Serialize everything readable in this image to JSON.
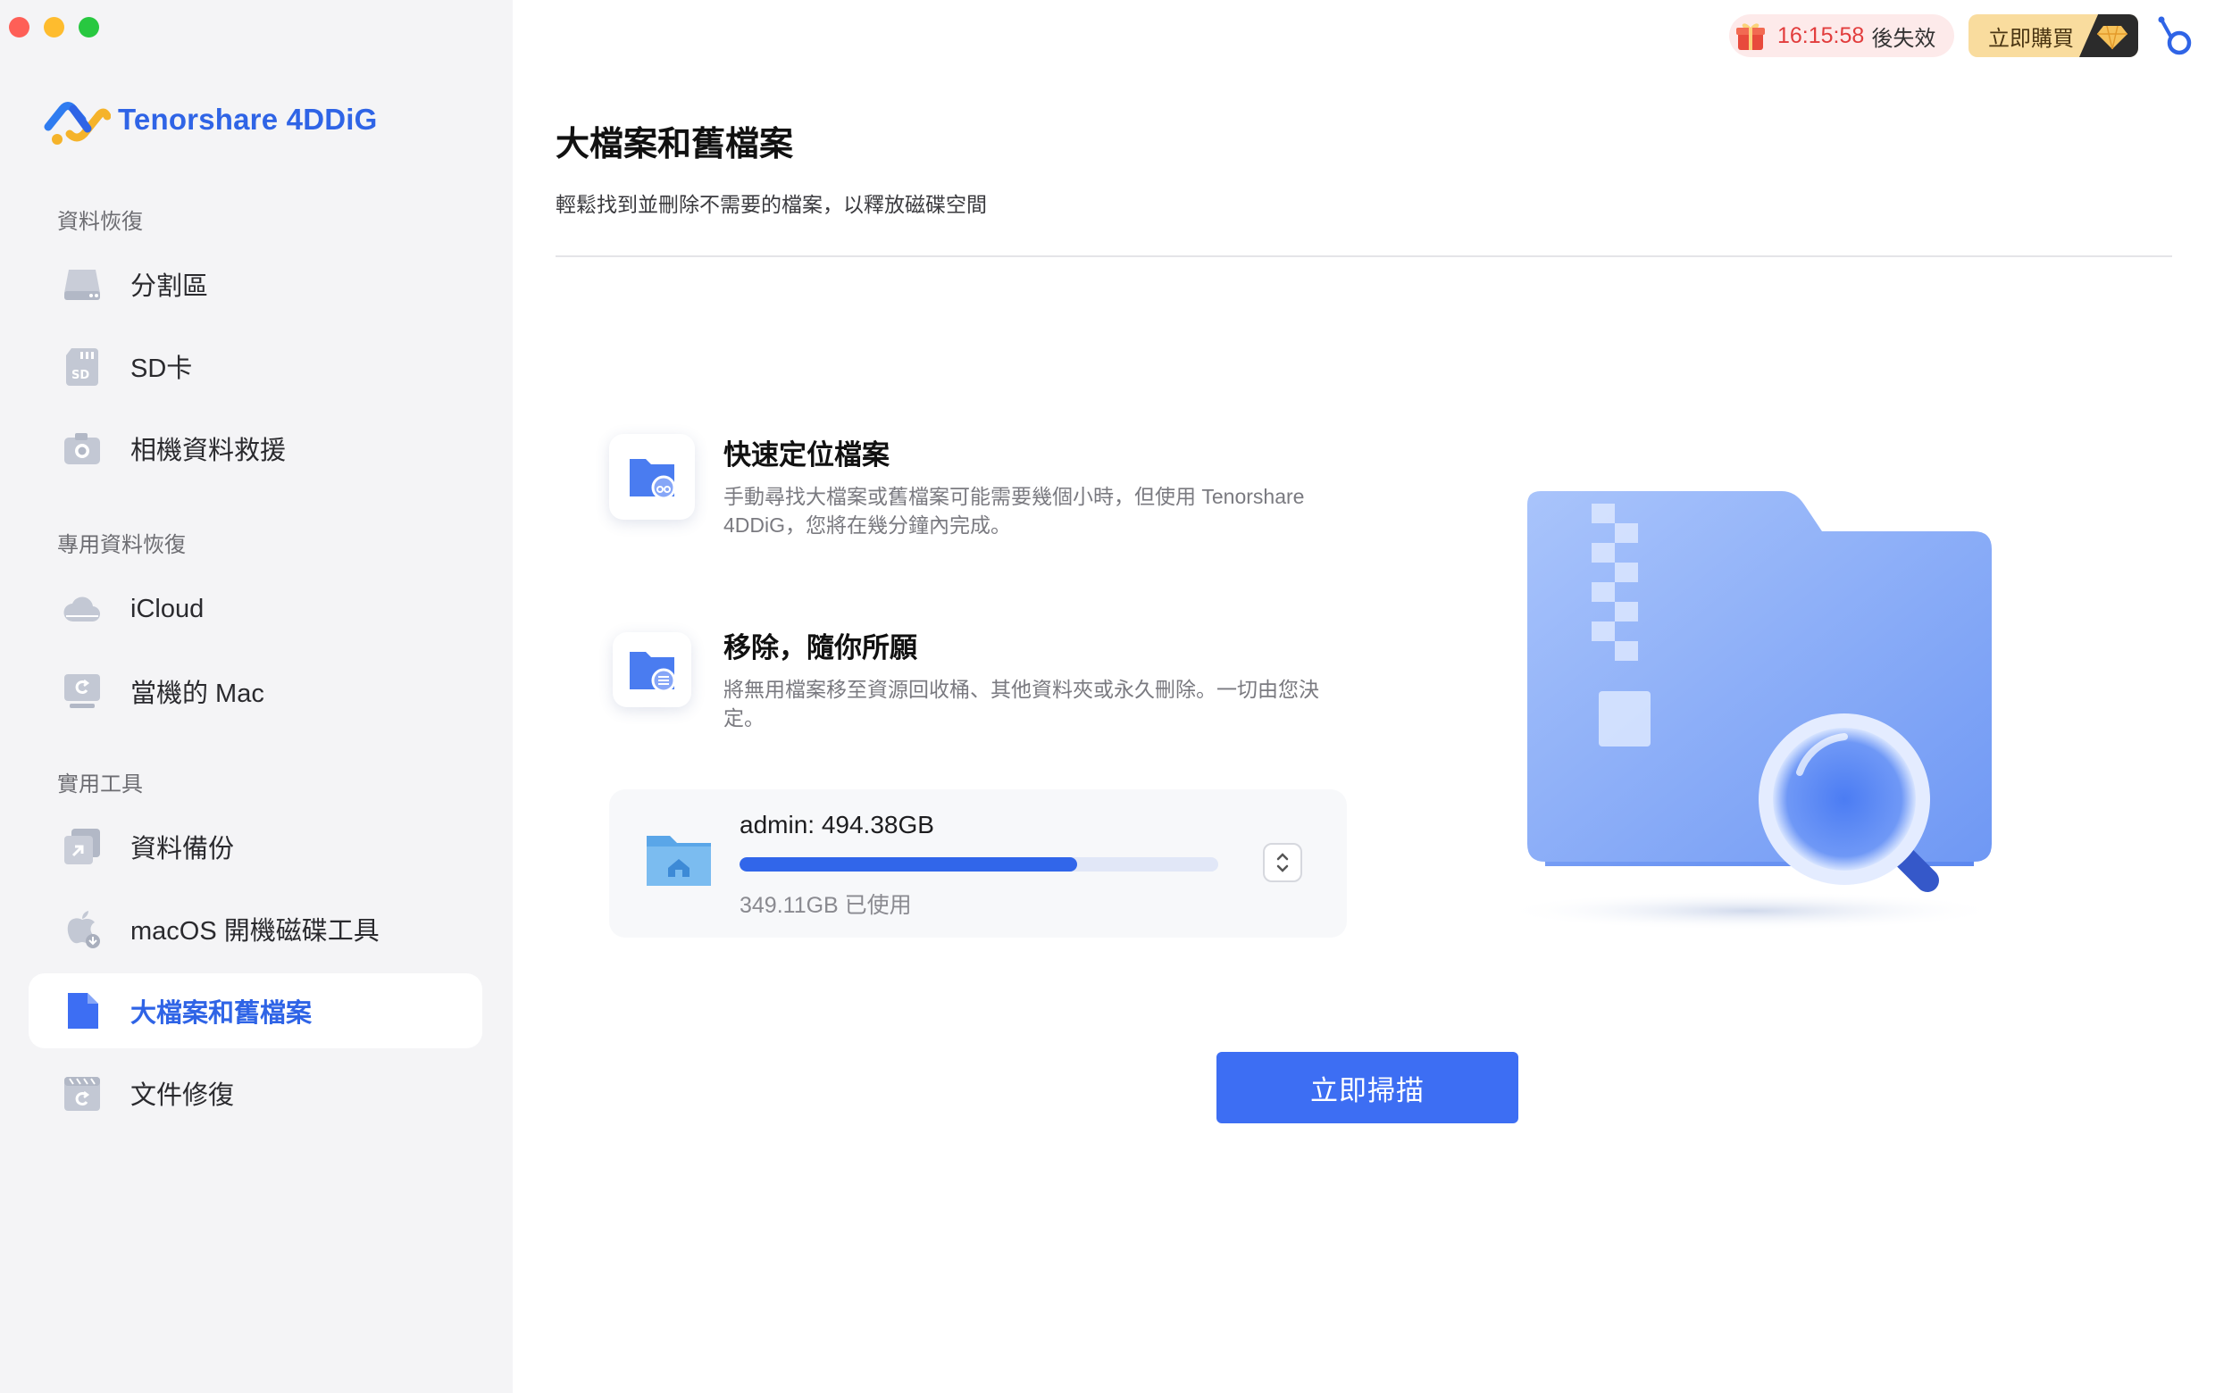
{
  "window": {
    "controls": [
      "close",
      "minimize",
      "zoom"
    ]
  },
  "brand": {
    "name": "Tenorshare 4DDiG",
    "logo_icon": "4ddig-logo-icon"
  },
  "sidebar": {
    "sections": [
      {
        "title": "資料恢復",
        "items": [
          {
            "label": "分割區",
            "icon": "drive-icon"
          },
          {
            "label": "SD卡",
            "icon": "sd-card-icon"
          },
          {
            "label": "相機資料救援",
            "icon": "camera-icon"
          }
        ]
      },
      {
        "title": "專用資料恢復",
        "items": [
          {
            "label": "iCloud",
            "icon": "cloud-icon"
          },
          {
            "label": "當機的 Mac",
            "icon": "crashed-mac-icon"
          }
        ]
      },
      {
        "title": "實用工具",
        "items": [
          {
            "label": "資料備份",
            "icon": "backup-icon"
          },
          {
            "label": "macOS 開機磁碟工具",
            "icon": "bootable-disk-icon"
          },
          {
            "label": "大檔案和舊檔案",
            "icon": "large-file-icon",
            "active": true
          },
          {
            "label": "文件修復",
            "icon": "document-repair-icon"
          }
        ]
      }
    ]
  },
  "topbar": {
    "timer": "16:15:58",
    "timer_suffix": "後失效",
    "buy_label": "立即購買",
    "accent_red": "#e23c3c",
    "buy_bg": "#f9dc9e"
  },
  "main": {
    "title": "大檔案和舊檔案",
    "subtitle": "輕鬆找到並刪除不需要的檔案，以釋放磁碟空間",
    "features": [
      {
        "title": "快速定位檔案",
        "desc": "手動尋找大檔案或舊檔案可能需要幾個小時，但使用 Tenorshare 4DDiG，您將在幾分鐘內完成。",
        "icon": "locate-folder-icon"
      },
      {
        "title": "移除，隨你所願",
        "desc": "將無用檔案移至資源回收桶、其他資料夾或永久刪除。一切由您決定。",
        "icon": "remove-folder-icon"
      }
    ],
    "disk": {
      "name": "admin: 494.38GB",
      "used": "349.11GB 已使用",
      "used_fraction": 0.706,
      "icon": "home-folder-icon"
    },
    "scan_button": "立即掃描",
    "accent": "#3d6ef3"
  }
}
